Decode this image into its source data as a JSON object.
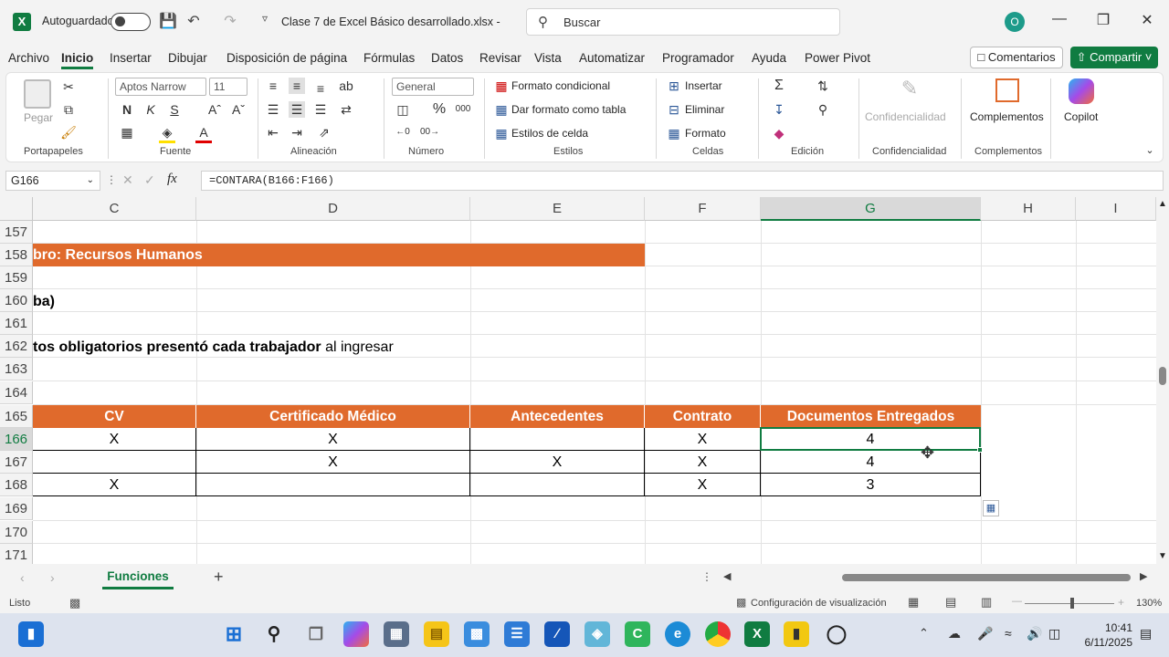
{
  "titlebar": {
    "autosave_label": "Autoguardado",
    "file_title": "Clase 7 de Excel Básico desarrollado.xlsx  -",
    "search_placeholder": "Buscar",
    "avatar_initial": "O"
  },
  "menu": {
    "items": [
      "Archivo",
      "Inicio",
      "Insertar",
      "Dibujar",
      "Disposición de página",
      "Fórmulas",
      "Datos",
      "Revisar",
      "Vista",
      "Automatizar",
      "Programador",
      "Ayuda",
      "Power Pivot"
    ],
    "active": "Inicio",
    "comments_label": "Comentarios",
    "share_label": "Compartir"
  },
  "ribbon": {
    "paste_label": "Pegar",
    "font_name": "Aptos Narrow",
    "font_size": "11",
    "bold": "N",
    "italic": "K",
    "underline": "S",
    "number_format": "General",
    "conditional_format": "Formato condicional",
    "format_as_table": "Dar formato como tabla",
    "cell_styles": "Estilos de celda",
    "insert": "Insertar",
    "delete": "Eliminar",
    "format": "Formato",
    "sensitivity": "Confidencialidad",
    "addins": "Complementos",
    "copilot": "Copilot",
    "groups": {
      "clipboard": "Portapapeles",
      "font": "Fuente",
      "alignment": "Alineación",
      "number": "Número",
      "styles": "Estilos",
      "cells": "Celdas",
      "editing": "Edición",
      "sensitivity": "Confidencialidad",
      "addins": "Complementos"
    }
  },
  "formula_bar": {
    "name_box": "G166",
    "fx": "fx",
    "formula": "=CONTARA(B166:F166)"
  },
  "grid": {
    "columns": [
      "C",
      "D",
      "E",
      "F",
      "G",
      "H",
      "I"
    ],
    "selected_column": "G",
    "rows": [
      "157",
      "158",
      "159",
      "160",
      "161",
      "162",
      "163",
      "164",
      "165",
      "166",
      "167",
      "168",
      "169",
      "170",
      "171"
    ],
    "selected_row": "166",
    "banner_text": "bro: Recursos Humanos",
    "row160_text": "ba)",
    "row162_bold": "tos obligatorios presentó cada trabajador",
    "row162_normal": " al ingresar",
    "table_headers": [
      "CV",
      "Certificado Médico",
      "Antecedentes",
      "Contrato",
      "Documentos Entregados"
    ],
    "table_rows": [
      [
        "X",
        "X",
        "",
        "X",
        "4"
      ],
      [
        "",
        "X",
        "X",
        "X",
        "4"
      ],
      [
        "X",
        "",
        "",
        "X",
        "3"
      ]
    ]
  },
  "sheets": {
    "active_tab": "Funciones",
    "add_label": "+"
  },
  "status": {
    "ready": "Listo",
    "display_settings": "Configuración de visualización",
    "zoom": "130%"
  },
  "taskbar": {
    "time": "10:41",
    "date": "6/11/2025"
  },
  "colors": {
    "excel_green": "#107c41",
    "table_header_orange": "#e06a2c"
  }
}
